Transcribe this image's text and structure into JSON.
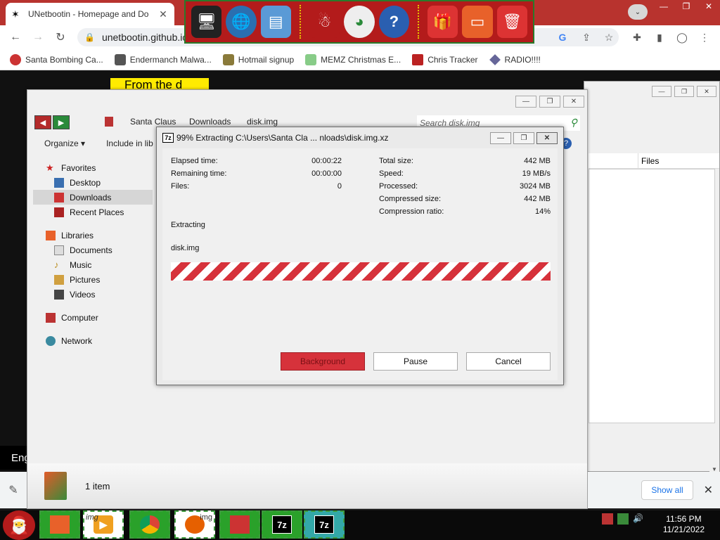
{
  "chrome": {
    "tab_title": "UNetbootin - Homepage and Do",
    "url": "unetbootin.github.io",
    "bookmarks": [
      {
        "label": "Santa Bombing Ca...",
        "icon": "santa-icon"
      },
      {
        "label": "Endermanch Malwa...",
        "icon": "skull-icon"
      },
      {
        "label": "Hotmail signup",
        "icon": "person-icon"
      },
      {
        "label": "MEMZ Christmas E...",
        "icon": "memz-icon"
      },
      {
        "label": "Chris Tracker",
        "icon": "chris-icon"
      },
      {
        "label": "RADIO!!!!",
        "icon": "radio-icon"
      }
    ]
  },
  "web_page": {
    "yellow_label": "From the d",
    "language_label": "Eng"
  },
  "right_window": {
    "files_header": "Files"
  },
  "explorer": {
    "breadcrumbs": [
      "Santa Claus",
      "Downloads",
      "disk.img"
    ],
    "search_placeholder": "Search disk.img",
    "organize_label": "Organize",
    "include_label": "Include in lib",
    "favorites_label": "Favorites",
    "favorites": [
      "Desktop",
      "Downloads",
      "Recent Places"
    ],
    "libraries_label": "Libraries",
    "libraries": [
      "Documents",
      "Music",
      "Pictures",
      "Videos"
    ],
    "computer_label": "Computer",
    "network_label": "Network",
    "status_text": "1 item"
  },
  "zip": {
    "title": "99% Extracting C:\\Users\\Santa Cla ... nloads\\disk.img.xz",
    "elapsed_label": "Elapsed time:",
    "elapsed_value": "00:00:22",
    "remaining_label": "Remaining time:",
    "remaining_value": "00:00:00",
    "files_label": "Files:",
    "files_value": "0",
    "total_size_label": "Total size:",
    "total_size_value": "442 MB",
    "speed_label": "Speed:",
    "speed_value": "19 MB/s",
    "processed_label": "Processed:",
    "processed_value": "3024 MB",
    "compressed_label": "Compressed size:",
    "compressed_value": "442 MB",
    "ratio_label": "Compression ratio:",
    "ratio_value": "14%",
    "status_label": "Extracting",
    "file_name": "disk.img",
    "progress_percent": 99,
    "progress_color": "#d6323b",
    "background_button": "Background",
    "pause_button": "Pause",
    "cancel_button": "Cancel"
  },
  "notification": {
    "show_all": "Show all"
  },
  "taskbar": {
    "seven_zip_label": "7z",
    "img_label": "img",
    "img_label_2": "img",
    "time": "11:56 PM",
    "date": "11/21/2022"
  }
}
